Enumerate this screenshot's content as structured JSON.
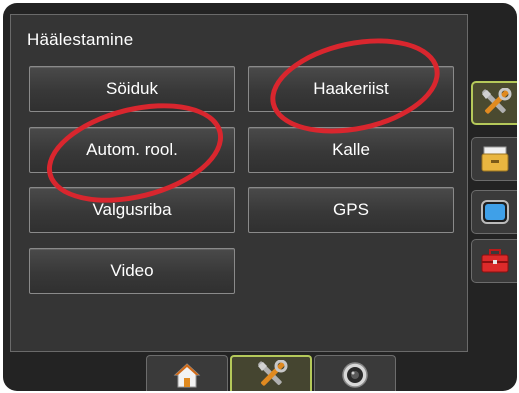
{
  "panel": {
    "title": "Häälestamine",
    "buttons": {
      "vehicle": "Söiduk",
      "implement": "Haakeriist",
      "auto_steer": "Autom. rool.",
      "tilt": "Kalle",
      "lightbar": "Valgusriba",
      "gps": "GPS",
      "video": "Video"
    }
  },
  "annotations": {
    "highlight_color": "#d9262e",
    "highlighted": [
      "Haakeriist",
      "Autom. rool."
    ]
  },
  "side_tabs": [
    {
      "icon": "tools-icon",
      "active": true
    },
    {
      "icon": "folder-icon",
      "active": false
    },
    {
      "icon": "screen-icon",
      "active": false
    },
    {
      "icon": "toolbox-icon",
      "active": false
    }
  ],
  "bottom_tabs": [
    {
      "icon": "home-icon",
      "active": false
    },
    {
      "icon": "tools-icon",
      "active": true
    },
    {
      "icon": "camera-icon",
      "active": false
    }
  ],
  "colors": {
    "active_tab_border": "#b5c95a",
    "panel_bg": "#353535",
    "device_bg": "#232323"
  }
}
